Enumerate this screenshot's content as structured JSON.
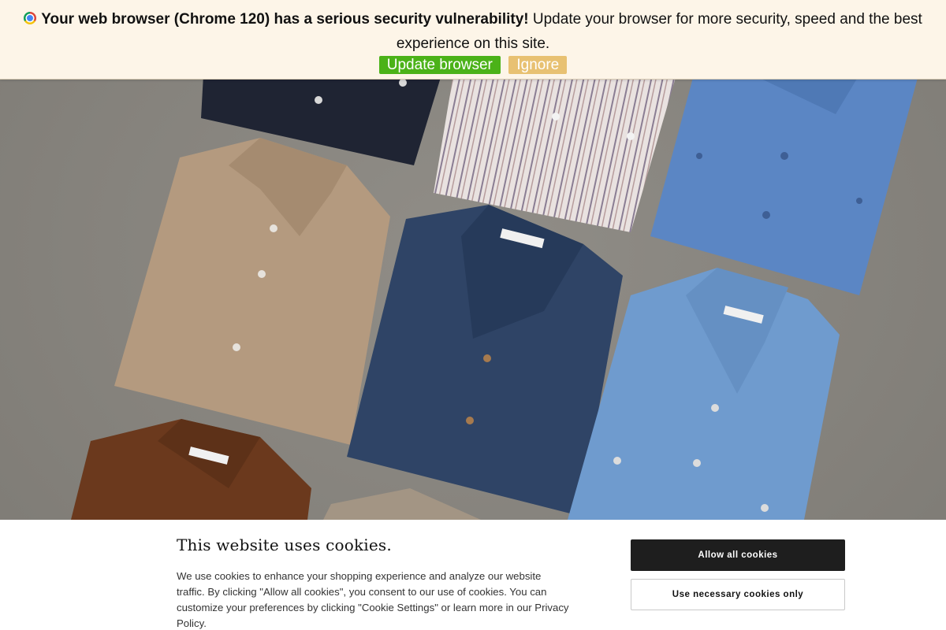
{
  "banner": {
    "headline": "Your web browser (Chrome 120) has a serious security vulnerability!",
    "message": "Update your browser for more security, speed and the best experience on this site.",
    "update_label": "Update browser",
    "ignore_label": "Ignore",
    "icon": "chrome-icon"
  },
  "hero": {
    "image": "flat-lay of folded shirts"
  },
  "cookie": {
    "title": "This website uses cookies.",
    "text": "We use cookies to enhance your shopping experience and analyze our website traffic. By clicking \"Allow all cookies\", you consent to our use of cookies. You can customize your preferences by clicking \"Cookie Settings\" or learn more in our Privacy Policy.",
    "allow_label": "Allow all cookies",
    "necessary_label": "Use necessary cookies only"
  },
  "colors": {
    "update_button": "#4bb218",
    "ignore_button": "#e8c172",
    "banner_bg": "#fdf5e8",
    "allow_button": "#1e1e1e"
  }
}
